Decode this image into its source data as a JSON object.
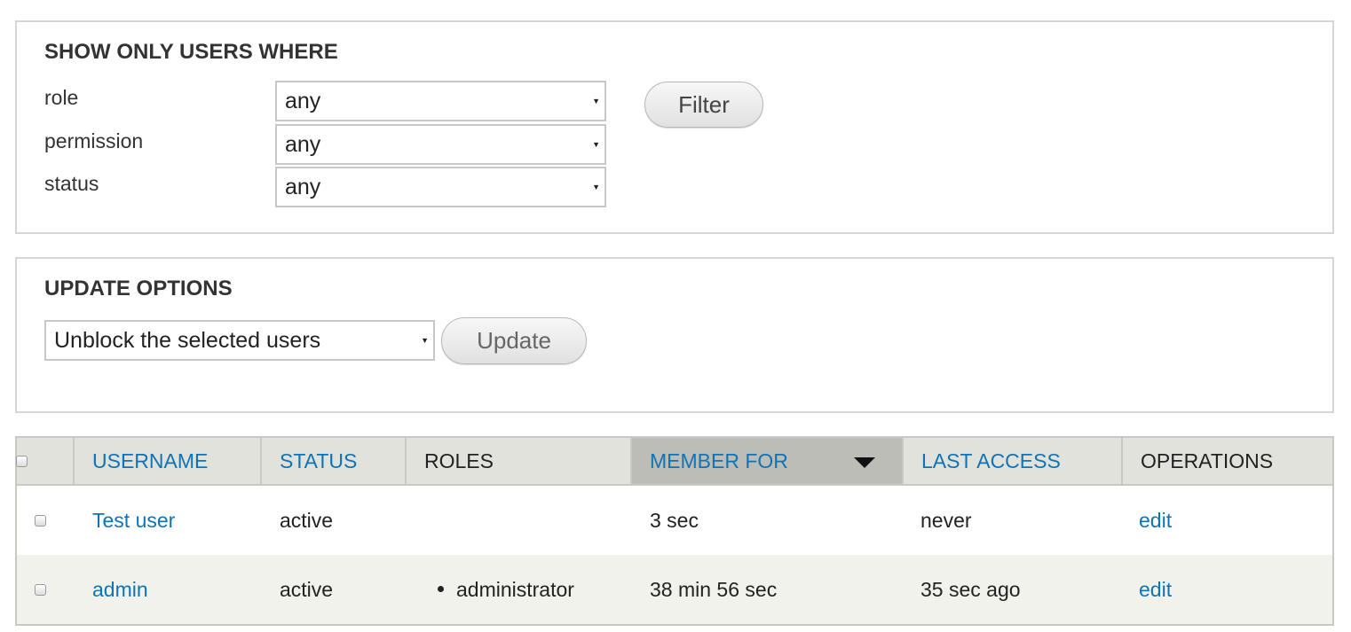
{
  "filters": {
    "legend": "SHOW ONLY USERS WHERE",
    "fields": [
      {
        "label": "role",
        "value": "any"
      },
      {
        "label": "permission",
        "value": "any"
      },
      {
        "label": "status",
        "value": "any"
      }
    ],
    "filter_button": "Filter"
  },
  "update": {
    "legend": "UPDATE OPTIONS",
    "action_value": "Unblock the selected users",
    "update_button": "Update"
  },
  "table": {
    "headers": {
      "username": "USERNAME",
      "status": "STATUS",
      "roles": "ROLES",
      "member_for": "MEMBER FOR",
      "last_access": "LAST ACCESS",
      "operations": "OPERATIONS"
    },
    "sorted_column": "member_for",
    "sort_direction": "descending",
    "rows": [
      {
        "username": "Test user",
        "status": "active",
        "roles": "",
        "member_for": "3 sec",
        "last_access": "never",
        "operation": "edit"
      },
      {
        "username": "admin",
        "status": "active",
        "roles": "administrator",
        "member_for": "38 min 56 sec",
        "last_access": "35 sec ago",
        "operation": "edit"
      }
    ]
  },
  "colors": {
    "link": "#0f74b7",
    "header_bg": "#e1e2dc",
    "active_header_bg": "#bdbdb7",
    "even_row_bg": "#f2f2ec"
  }
}
